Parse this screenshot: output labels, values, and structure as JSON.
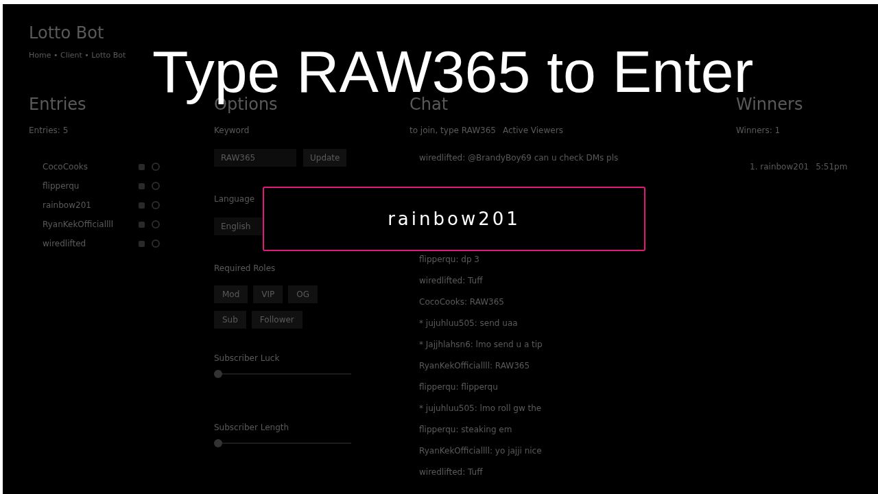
{
  "overlay": {
    "title": "Type RAW365 to Enter",
    "winner": "rainbow201"
  },
  "app": {
    "title": "Lotto Bot",
    "breadcrumb": "Home • Client • Lotto Bot"
  },
  "entries": {
    "heading": "Entries",
    "label": "Entries: 5",
    "items": [
      "CocoCooks",
      "flipperqu",
      "rainbow201",
      "RyanKekOfficiallll",
      "wiredlifted"
    ]
  },
  "options": {
    "heading": "Options",
    "keyword_label": "Keyword",
    "keyword_value": "RAW365",
    "update": "Update",
    "language_label": "Language",
    "language": "English",
    "roles_label": "Required Roles",
    "roles": [
      {
        "label": "Mod",
        "selected": false
      },
      {
        "label": "VIP",
        "selected": false
      },
      {
        "label": "OG",
        "selected": false
      },
      {
        "label": "Sub",
        "selected": false
      },
      {
        "label": "Follower",
        "selected": false
      }
    ],
    "sliders": [
      {
        "label": "Subscriber Luck",
        "level": 0
      },
      {
        "label": "Subscriber Length",
        "level": 0
      }
    ]
  },
  "chat": {
    "heading": "Chat",
    "join": "to join, type RAW365",
    "viewers": "Active Viewers",
    "messages": [
      "wiredlifted: @BrandyBoy69 can u check DMs pls",
      "flipperqu: dp 3",
      "wiredlifted: Tuff",
      "CocoCooks: RAW365",
      "* jujuhluu505: send uaa",
      "* Jajjhlahsn6: lmo send u a tip",
      "RyanKekOfficiallll: RAW365",
      "flipperqu: flipperqu",
      "* jujuhluu505: lmo roll gw the",
      "flipperqu: steaking em",
      "RyanKekOfficiallll: yo jajji nice",
      "wiredlifted: Tuff"
    ]
  },
  "winners": {
    "heading": "Winners",
    "label": "Winners: 1",
    "items": [
      {
        "name": "1. rainbow201",
        "time": "5:51pm"
      }
    ]
  }
}
